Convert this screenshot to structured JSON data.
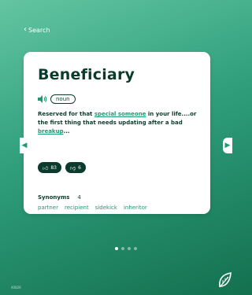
{
  "nav": {
    "back_label": "Search"
  },
  "entry": {
    "word": "Beneficiary",
    "part_of_speech": "noun",
    "definition": {
      "part1": "Reserved for that ",
      "link1": "special someone",
      "part2": " in your life....or the first thing that needs updating after a bad ",
      "link2": "breakup",
      "part3": "..."
    },
    "upvotes": "83",
    "downvotes": "6"
  },
  "synonyms": {
    "title": "Synonyms",
    "count": "4",
    "items": [
      "partner",
      "recipient",
      "sidekick",
      "inheritor"
    ]
  },
  "pagination": {
    "total": 4,
    "active": 0
  },
  "footer": {
    "text": "40826"
  },
  "colors": {
    "accent": "#1e9a6f",
    "dark": "#0b3b2c",
    "background_top": "#63c5a2",
    "background_bottom": "#13704f"
  },
  "icons": [
    "chevron-left-icon",
    "speaker-icon",
    "thumbs-up-icon",
    "thumbs-down-icon",
    "arrow-left-icon",
    "arrow-right-icon",
    "leaf-logo-icon"
  ]
}
